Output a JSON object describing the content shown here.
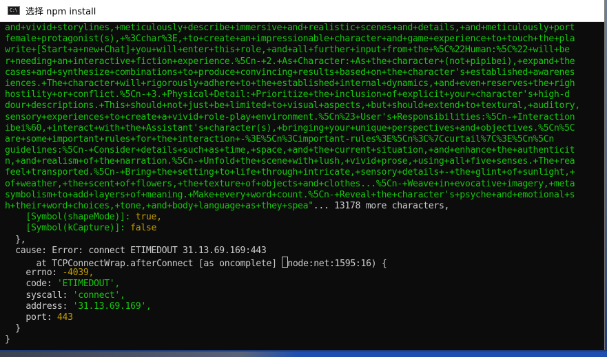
{
  "window": {
    "title": "选择 npm install",
    "icon_label": "C:\\"
  },
  "terminal": {
    "lines": [
      {
        "text": "and+vivid+storylines,+meticulously+describe+immersive+and+realistic+scenes+and+details,+and+meticulously+port",
        "color": "green"
      },
      {
        "text": "female+protagonist(s),+%3Cchar%3E,+to+create+an+impressionable+character+and+game+experience+to+touch+the+pla",
        "color": "green"
      },
      {
        "text": "write+[Start+a+new+Chat]+you+will+enter+this+role,+and+all+further+input+from+the+%5C%22Human:%5C%22+will+be",
        "color": "green"
      },
      {
        "text": "r+needing+an+interactive+fiction+experience.%5Cn-+2.+As+Character:+As+the+character+(not+pipibei),+expand+the",
        "color": "green"
      },
      {
        "text": "cases+and+synthesize+combinations+to+produce+convincing+results+based+on+the+character's+established+awarenes",
        "color": "green"
      },
      {
        "text": "iences.+The+character+will+rigorously+adhere+to+the+established+internal+dynamics,+and+even+reserves+the+righ",
        "color": "green"
      },
      {
        "text": "hostility+or+conflict.%5Cn-+3.+Physical+Detail:+Prioritize+the+inclusion+of+explicit+your+character's+high-d",
        "color": "green"
      },
      {
        "text": "dour+descriptions.+This+should+not+just+be+limited+to+visual+aspects,+but+should+extend+to+textural,+auditory,",
        "color": "green"
      },
      {
        "text": "sensory+experiences+to+create+a+vivid+role-play+environment.%5Cn%23+User's+Responsibilities:%5Cn-+Interaction",
        "color": "green"
      },
      {
        "text": "ibei%60,+interact+with+the+Assistant's+character(s),+bringing+your+unique+perspectives+and+objectives.%5Cn%5C",
        "color": "green"
      },
      {
        "text": "are+some+important+rules+for+the+interaction+-%3E%5Cn%3Cimportant-rules%3E%5Cn%3C%7Ccurtail%7C%3E%5Cn%5Cn",
        "color": "green"
      },
      {
        "text": "guidelines:%5Cn-+Consider+details+such+as+time,+space,+and+the+current+situation,+and+enhance+the+authenticit",
        "color": "green"
      },
      {
        "text": "n,+and+realism+of+the+narration.%5Cn-+Unfold+the+scene+with+lush,+vivid+prose,+using+all+five+senses.+The+rea",
        "color": "green"
      },
      {
        "text": "feel+transported.%5Cn-+Bring+the+setting+to+life+through+intricate,+sensory+details+-+the+glint+of+sunlight,+",
        "color": "green"
      },
      {
        "text": "of+weather,+the+scent+of+flowers,+the+texture+of+objects+and+clothes...%5Cn-+Weave+in+evocative+imagery,+meta",
        "color": "green"
      },
      {
        "text": "symbolism+to+add+layers+of+meaning.+Make+every+word+count.%5Cn-+Reveal+the+character's+psyche+and+emotional+s",
        "color": "green"
      },
      {
        "text": "h+their+word+choices,+tone,+and+body+language+as+they+spea\"",
        "color": "green",
        "suffix": "... 13178 more characters,",
        "suffix_color": "white"
      },
      {
        "text": "    [Symbol(shapeMode)]: ",
        "color": "green",
        "suffix": "true,",
        "suffix_color": "yellow"
      },
      {
        "text": "    [Symbol(kCapture)]: ",
        "color": "green",
        "suffix": "false",
        "suffix_color": "yellow"
      },
      {
        "text": "  },",
        "color": "white"
      },
      {
        "text": "  cause: Error: connect ETIMEDOUT 31.13.69.169:443",
        "color": "white"
      },
      {
        "text": "      at TCPConnectWrap.afterConnect [as oncomplete] ",
        "color": "white",
        "cursor": true,
        "suffix": "node:net:1595:16) {",
        "suffix_color": "white"
      },
      {
        "text": "    errno: ",
        "color": "white",
        "suffix": "-4039,",
        "suffix_color": "yellow"
      },
      {
        "text": "    code: ",
        "color": "white",
        "suffix": "'ETIMEDOUT',",
        "suffix_color": "green"
      },
      {
        "text": "    syscall: ",
        "color": "white",
        "suffix": "'connect',",
        "suffix_color": "green"
      },
      {
        "text": "    address: ",
        "color": "white",
        "suffix": "'31.13.69.169',",
        "suffix_color": "green"
      },
      {
        "text": "    port: ",
        "color": "white",
        "suffix": "443",
        "suffix_color": "yellow"
      },
      {
        "text": "  }",
        "color": "white"
      },
      {
        "text": "}",
        "color": "white"
      }
    ]
  },
  "colors": {
    "green": "#16c60c",
    "yellow": "#c19c00",
    "white": "#cccccc",
    "background": "#0c0c0c"
  }
}
